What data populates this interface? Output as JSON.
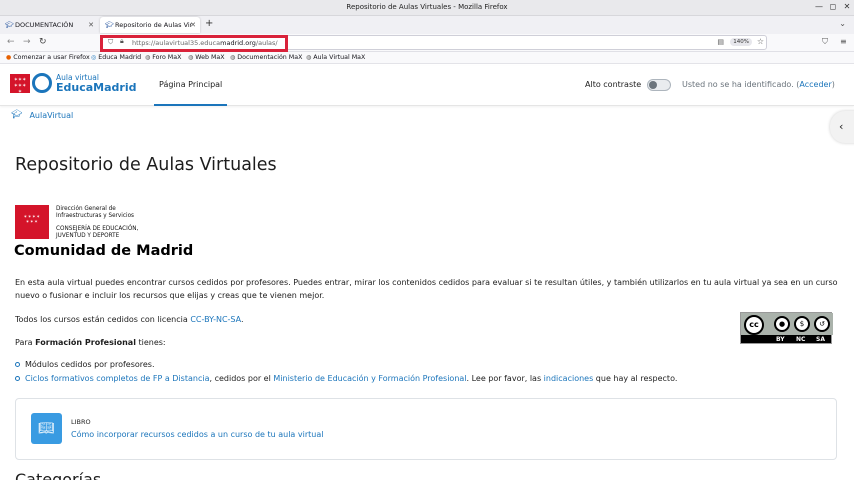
{
  "window": {
    "title": "Repositorio de Aulas Virtuales - Mozilla Firefox"
  },
  "tabs": [
    {
      "label": "DOCUMENTACIÓN"
    },
    {
      "label": "Repositorio de Aulas Vir"
    }
  ],
  "navbar": {
    "url_prefix": "https://aulavirtual35.educa",
    "url_domain": "madrid.org",
    "url_suffix": "/aulas/",
    "zoom": "140%"
  },
  "bookmarks": [
    {
      "label": "Comenzar a usar Firefox"
    },
    {
      "label": "Educa Madrid"
    },
    {
      "label": "Foro MaX"
    },
    {
      "label": "Web MaX"
    },
    {
      "label": "Documentación MaX"
    },
    {
      "label": "Aula Virtual MaX"
    }
  ],
  "site": {
    "logo_small": "Aula virtual",
    "logo_big": "EducaMadrid",
    "nav_home": "Página Principal",
    "contrast_label": "Alto contraste",
    "login_prefix": "Usted no se ha identificado. (",
    "login_link": "Acceder",
    "login_suffix": ")"
  },
  "breadcrumb": {
    "label": "AulaVirtual"
  },
  "content": {
    "title": "Repositorio de Aulas Virtuales",
    "cam_line1a": "Dirección General de",
    "cam_line1b": "Infraestructuras y Servicios",
    "cam_line2a": "CONSEJERÍA DE EDUCACIÓN,",
    "cam_line2b": "JUVENTUD Y DEPORTE",
    "cam_big": "Comunidad de Madrid",
    "intro": "En esta aula virtual puedes encontrar cursos cedidos por profesores. Puedes entrar, mirar los contenidos cedidos para evaluar si te resultan útiles, y también utilizarlos en tu aula virtual ya sea en un curso nuevo o fusionar e incluir los recursos que elijas y creas que te vienen mejor.",
    "license_prefix": "Todos los cursos están cedidos con licencia ",
    "license_link": "CC-BY-NC-SA",
    "license_suffix": ".",
    "fp_prefix": "Para ",
    "fp_bold": "Formación Profesional",
    "fp_suffix": " tienes:",
    "item1": "Módulos cedidos por profesores.",
    "item2_link1": "Ciclos formativos completos de FP a Distancia",
    "item2_mid": ", cedidos por el ",
    "item2_link2": "Ministerio de Educación y Formación Profesional",
    "item2_mid2": ". Lee por favor, las ",
    "item2_link3": "indicaciones",
    "item2_end": " que hay al respecto.",
    "card_type": "LIBRO",
    "card_link": "Cómo incorporar recursos cedidos a un curso de tu aula virtual",
    "next_heading": "Categorías"
  },
  "cc_badge": {
    "cc": "cc",
    "by": "BY",
    "nc": "NC",
    "sa": "SA"
  }
}
